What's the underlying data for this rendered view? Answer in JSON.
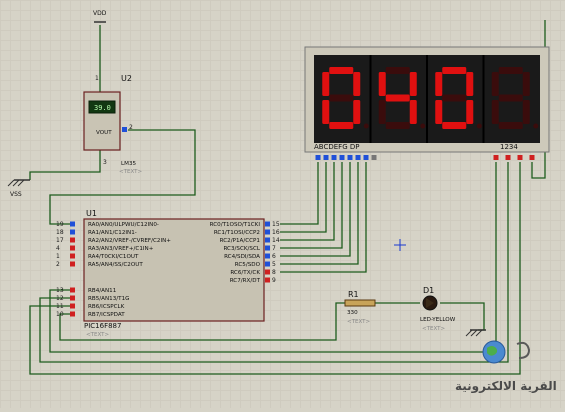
{
  "vdd_label": "VDD",
  "vss_label": "VSS",
  "u2": {
    "ref": "U2",
    "part": "LM35",
    "placeholder": "<TEXT>",
    "reading": "39.0",
    "vout": "VOUT",
    "pin1": "1",
    "pin2": "2",
    "pin3": "3"
  },
  "u1": {
    "ref": "U1",
    "part": "PIC16F887",
    "placeholder": "<TEXT>",
    "left_pins": [
      {
        "num": "19",
        "label": "RA0/AN0/ULPWU/C12IN0-"
      },
      {
        "num": "18",
        "label": "RA1/AN1/C12IN1-"
      },
      {
        "num": "17",
        "label": "RA2/AN2/VREF-/CVREF/C2IN+"
      },
      {
        "num": "4",
        "label": "RA3/AN3/VREF+/C1IN+"
      },
      {
        "num": "1",
        "label": "RA4/T0CKI/C1OUT"
      },
      {
        "num": "2",
        "label": "RA5/AN4/SS/C2OUT"
      },
      {
        "num": "13",
        "label": "RB4/AN11"
      },
      {
        "num": "12",
        "label": "RB5/AN13/T1G"
      },
      {
        "num": "11",
        "label": "RB6/ICSPCLK"
      },
      {
        "num": "10",
        "label": "RB7/ICSPDAT"
      }
    ],
    "right_pins": [
      {
        "num": "15",
        "label": "RC0/T1OSO/T1CKI"
      },
      {
        "num": "16",
        "label": "RC1/T1OSI/CCP2"
      },
      {
        "num": "14",
        "label": "RC2/P1A/CCP1"
      },
      {
        "num": "7",
        "label": "RC3/SCK/SCL"
      },
      {
        "num": "6",
        "label": "RC4/SDI/SDA"
      },
      {
        "num": "5",
        "label": "RC5/SDO"
      },
      {
        "num": "8",
        "label": "RC6/TX/CK"
      },
      {
        "num": "9",
        "label": "RC7/RX/DT"
      }
    ]
  },
  "display": {
    "digits": [
      "0",
      "4",
      "0",
      ""
    ],
    "segments_label": "ABCDEFG  DP",
    "digit_select_label": "1234",
    "color": "#e01010"
  },
  "r1": {
    "ref": "R1",
    "value": "330",
    "placeholder": "<TEXT>"
  },
  "d1": {
    "ref": "D1",
    "part": "LED-YELLOW",
    "placeholder": "<TEXT>"
  },
  "colors": {
    "wire": "#1d5c1d",
    "chip_fill": "#c7c2b2",
    "display_body": "#1a1a1a",
    "pin_pos": "#2050d8",
    "pin_neg": "#d02020",
    "pin_neutral": "#777777"
  },
  "watermark": {
    "text": "القرية الالكترونية"
  }
}
